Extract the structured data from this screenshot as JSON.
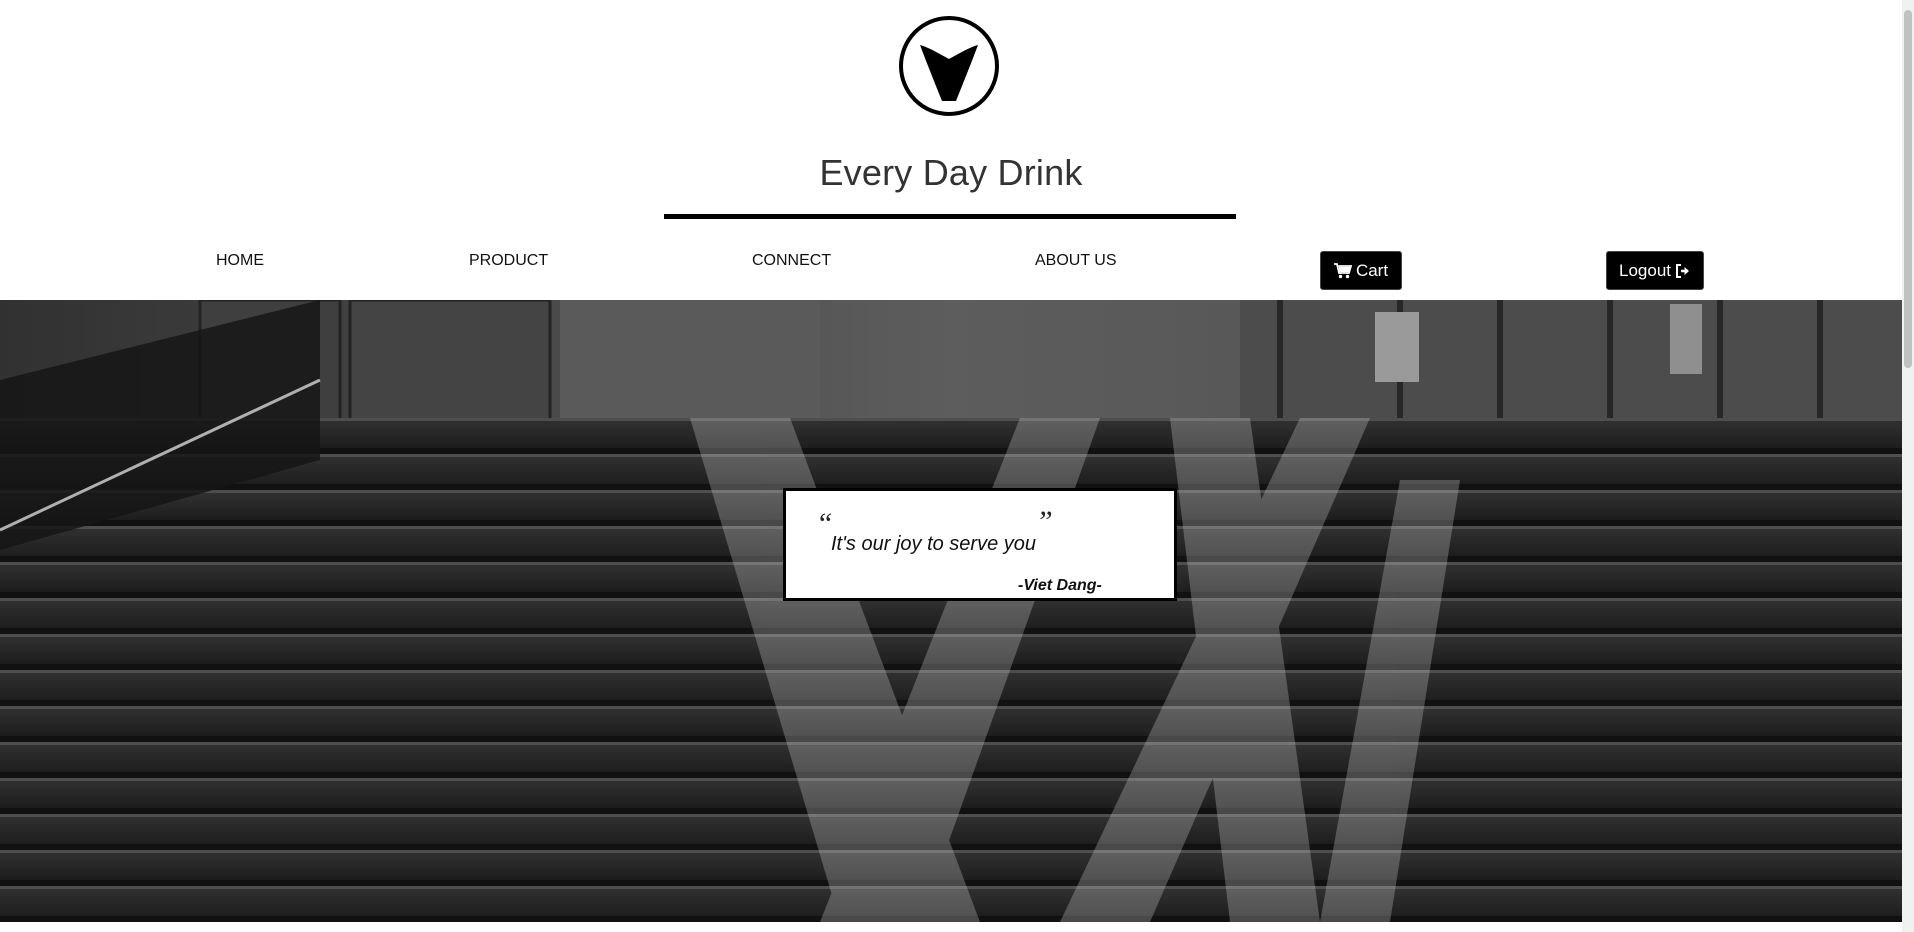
{
  "brand": {
    "logo_icon": "v-circle-logo",
    "title": "Every Day Drink"
  },
  "nav": {
    "items": [
      {
        "label": "HOME"
      },
      {
        "label": "PRODUCT"
      },
      {
        "label": "CONNECT"
      },
      {
        "label": "ABOUT US"
      }
    ],
    "cart_label": "Cart",
    "cart_icon": "shopping-cart-icon",
    "logout_label": "Logout",
    "logout_icon": "sign-out-icon"
  },
  "hero": {
    "background_icon": "staircase-photo",
    "quote_open": "“",
    "quote_close": "”",
    "quote_text": "It's our joy to serve you",
    "quote_author": "-Viet Dang-"
  },
  "colors": {
    "accent": "#000000",
    "button_text": "#ffffff",
    "background": "#ffffff"
  }
}
